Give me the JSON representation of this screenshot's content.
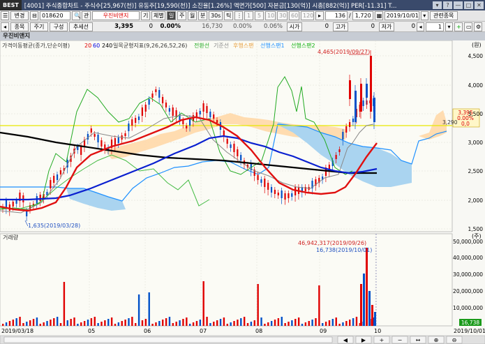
{
  "titlebar": {
    "logo": "BEST",
    "title": "[4001] 주식종합차트 - 주식수[25,967(천)] 유동주[19,590(천)] 소진율[1.26%] 액면가[500] 자본금[130(억)] 시총[882(억)] PER[-11.31] T...",
    "buttons": [
      "▾",
      "?",
      "—",
      "□",
      "✕"
    ]
  },
  "toolbar1": {
    "menu_label": "변경",
    "code_value": "018620",
    "search_icon": "🔍",
    "relation_label": "관",
    "stock_name": "우진비앤지",
    "period_buttons": [
      "기",
      "체별",
      "일",
      "주",
      "월",
      "분",
      "30s",
      "틱"
    ],
    "interval_buttons": [
      "1",
      "5",
      "10",
      "30",
      "60",
      "120"
    ],
    "count_value": "136",
    "divider": "/",
    "total_value": "1,720",
    "date_value": "2019/10/01",
    "save_label": "관련종목"
  },
  "toolbar2": {
    "buttons": [
      "종목",
      "주기",
      "구성",
      "추세선"
    ],
    "price": "3,395",
    "change": "0",
    "change_pct": "0.00%",
    "volume": "16,730",
    "v1": "0.00%",
    "v2": "0.06%",
    "open_label": "시가",
    "open_value": "0",
    "high_label": "고가",
    "high_value": "0",
    "low_label": "저가",
    "low_value": "0",
    "page_value": "1"
  },
  "namebar": {
    "title": "우진비앤지"
  },
  "chart": {
    "ma_legend": "가격이동평균(종가,단순이평)",
    "ma_periods": [
      {
        "label": "20",
        "color": "#e00000"
      },
      {
        "label": "60",
        "color": "#0000e0"
      },
      {
        "label": "240",
        "color": "#000000"
      }
    ],
    "ichimoku_legend": "일목균형지표(9,26,26,52,26)",
    "ichimoku_lines": [
      {
        "label": "전환선",
        "color": "#22aa22"
      },
      {
        "label": "기준선",
        "color": "#888888"
      },
      {
        "label": "후행스팬",
        "color": "#f3b866"
      },
      {
        "label": "선행스팬1",
        "color": "#1e90ff"
      },
      {
        "label": "선행스팬2",
        "color": "#10b010"
      }
    ],
    "price_axis": [
      "4,500",
      "4,000",
      "3,500",
      "3,000",
      "2,500",
      "2,000",
      "1,500"
    ],
    "price_axis_unit": "(원)",
    "high_annot": "4,465(2019/09/27)",
    "low_annot": "1,635(2019/03/28)",
    "price_box": [
      "3,395",
      "0.00%",
      "0,0"
    ],
    "level_label": "3,290",
    "volume_legend": "거래량",
    "volume_axis": [
      "50,000,000",
      "40,000,000",
      "30,000,000",
      "20,000,000",
      "10,000,000"
    ],
    "volume_axis_unit": "(주)",
    "vol_high_annot": "46,942,317(2019/09/26)",
    "vol_last_annot": "16,738(2019/10/01)",
    "vol_box": "16,738",
    "x_dates": [
      "2019/03/18",
      "05",
      "06",
      "07",
      "08",
      "09",
      "10",
      "2019/10/01"
    ],
    "bottom_icons": [
      "◀",
      "▶",
      "+",
      "−",
      "↔",
      "⊕",
      "⊖"
    ]
  },
  "colors": {
    "up": "#e00000",
    "down": "#0050c8",
    "cloud_blue": "#aad4f0",
    "cloud_orange": "#ffd8a8",
    "yellow_line": "#e8e800"
  }
}
